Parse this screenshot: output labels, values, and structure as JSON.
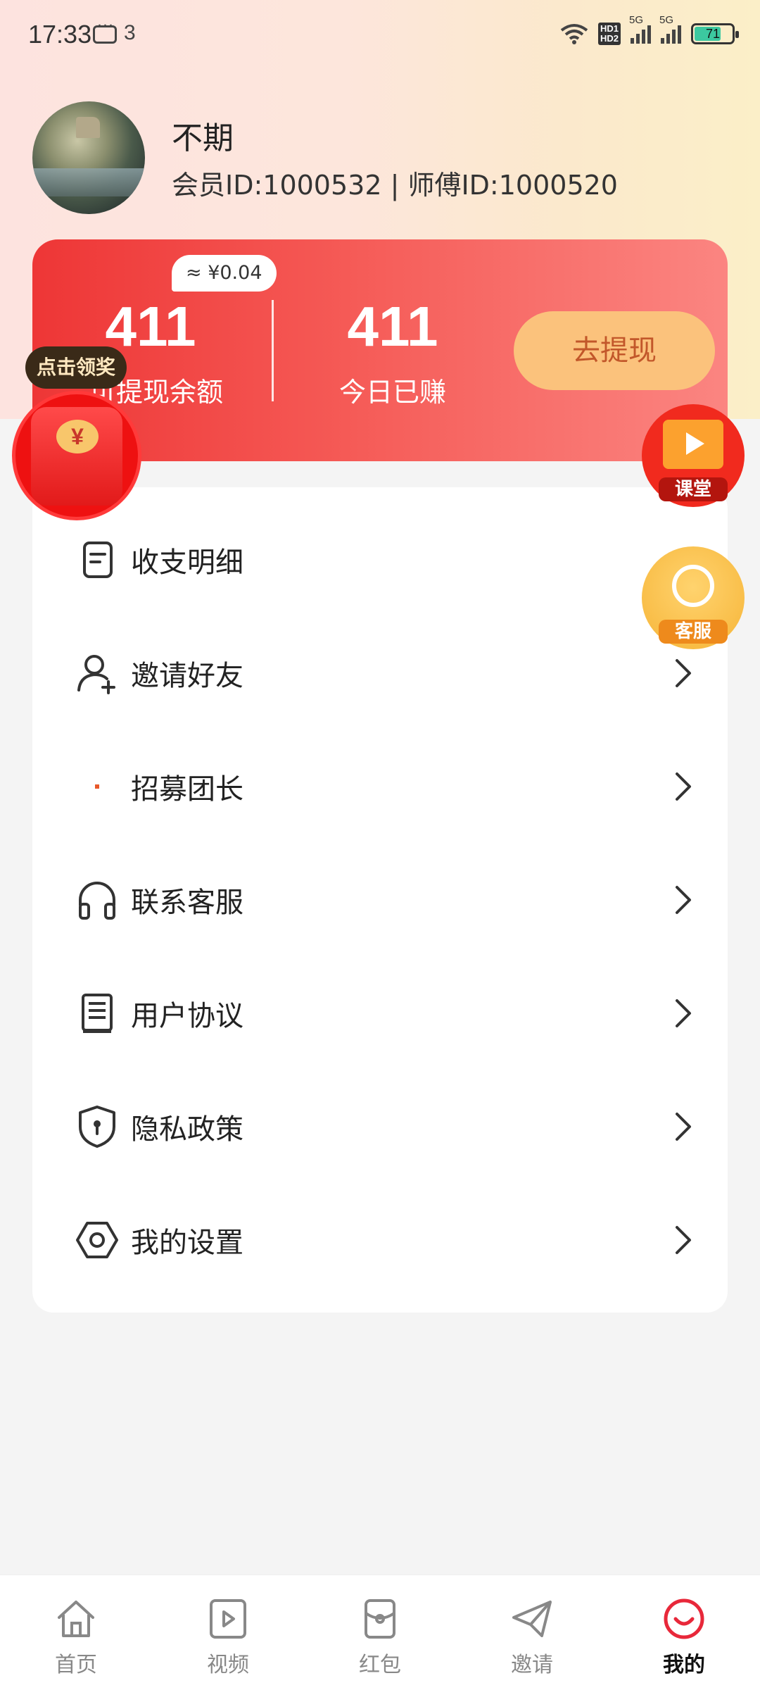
{
  "status_bar": {
    "time": "17:33",
    "notif_count": "3",
    "network": [
      "5G",
      "5G"
    ],
    "battery": "71"
  },
  "profile": {
    "name": "不期",
    "member_line": "会员ID:1000532 | 师傅ID:1000520"
  },
  "balance": {
    "approx": "≈ ¥0.04",
    "withdrawable_value": "411",
    "withdrawable_label": "可提现余额",
    "today_value": "411",
    "today_label": "今日已赚",
    "withdraw_button": "去提现"
  },
  "floating": {
    "claim_tip": "点击领奖",
    "coin_symbol": "¥",
    "classroom_label": "课堂",
    "service_label": "客服"
  },
  "menu": [
    {
      "label": "收支明细",
      "icon": "bill-icon"
    },
    {
      "label": "邀请好友",
      "icon": "add-user-icon"
    },
    {
      "label": "招募团长",
      "icon": "recruit-icon"
    },
    {
      "label": "联系客服",
      "icon": "headset-icon"
    },
    {
      "label": "用户协议",
      "icon": "document-icon"
    },
    {
      "label": "隐私政策",
      "icon": "shield-lock-icon"
    },
    {
      "label": "我的设置",
      "icon": "settings-icon"
    }
  ],
  "bottom_nav": [
    {
      "label": "首页",
      "icon": "home-icon"
    },
    {
      "label": "视频",
      "icon": "video-icon"
    },
    {
      "label": "红包",
      "icon": "red-packet-icon"
    },
    {
      "label": "邀请",
      "icon": "send-icon"
    },
    {
      "label": "我的",
      "icon": "smile-icon",
      "active": true
    }
  ],
  "colors": {
    "accent": "#ee3636",
    "withdraw_button_bg": "#fbc27c",
    "withdraw_button_text": "#c2572a",
    "active_nav_icon": "#e8283a"
  }
}
